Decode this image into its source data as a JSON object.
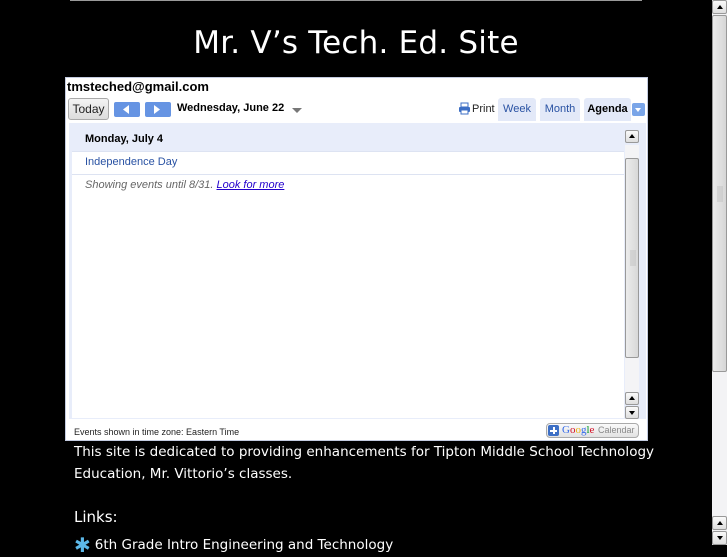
{
  "site": {
    "title": "Mr. V’s Tech. Ed. Site"
  },
  "calendar": {
    "account": "tmsteched@gmail.com",
    "today_label": "Today",
    "prev_icon": "chevron-left-icon",
    "next_icon": "chevron-right-icon",
    "current_date": "Wednesday, June 22",
    "print_label": "Print",
    "tabs": [
      {
        "label": "Week",
        "active": false
      },
      {
        "label": "Month",
        "active": false
      },
      {
        "label": "Agenda",
        "active": true
      }
    ],
    "agenda": {
      "day_header": "Monday, July 4",
      "events": [
        {
          "title": "Independence Day"
        }
      ],
      "showing_text": "Showing events until 8/31. ",
      "look_more_label": "Look for more"
    },
    "timezone_text": "Events shown in time zone: Eastern Time",
    "gcal_button": {
      "google_letters": [
        "G",
        "o",
        "o",
        "g",
        "l",
        "e"
      ],
      "google_colors": [
        "#3369e8",
        "#d50f25",
        "#eeb211",
        "#3369e8",
        "#009925",
        "#d50f25"
      ],
      "calendar_word": "Calendar"
    }
  },
  "content": {
    "intro": "This site is dedicated to providing enhancements for Tipton Middle School Technology Education, Mr. Vittorio’s classes.",
    "links_heading": "Links:",
    "links": [
      {
        "label": "6th Grade Intro Engineering and Technology",
        "icon": "asterisk-icon"
      }
    ]
  },
  "colors": {
    "background": "#000000",
    "link_blue": "#2952a3",
    "nav_blue": "#6694e3",
    "agenda_bg": "#e8edfa"
  }
}
